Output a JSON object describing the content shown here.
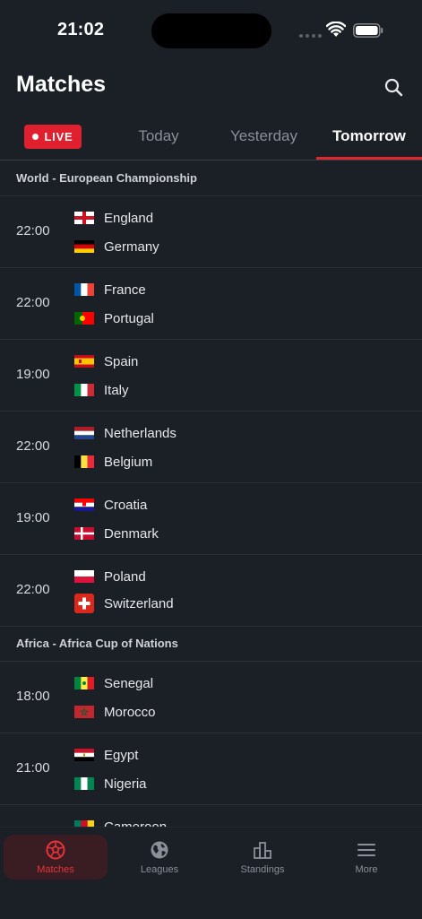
{
  "status": {
    "time": "21:02"
  },
  "header": {
    "title": "Matches",
    "search_icon": "search-icon"
  },
  "tabs": [
    {
      "label": "LIVE",
      "active": false
    },
    {
      "label": "Today",
      "active": false
    },
    {
      "label": "Yesterday",
      "active": false
    },
    {
      "label": "Tomorrow",
      "active": true
    }
  ],
  "leagues": [
    {
      "name": "World - European Championship",
      "matches": [
        {
          "time": "22:00",
          "home": "England",
          "away": "Germany"
        },
        {
          "time": "22:00",
          "home": "France",
          "away": "Portugal"
        },
        {
          "time": "19:00",
          "home": "Spain",
          "away": "Italy"
        },
        {
          "time": "22:00",
          "home": "Netherlands",
          "away": "Belgium"
        },
        {
          "time": "19:00",
          "home": "Croatia",
          "away": "Denmark"
        },
        {
          "time": "22:00",
          "home": "Poland",
          "away": "Switzerland"
        }
      ]
    },
    {
      "name": "Africa - Africa Cup of Nations",
      "matches": [
        {
          "time": "18:00",
          "home": "Senegal",
          "away": "Morocco"
        },
        {
          "time": "21:00",
          "home": "Egypt",
          "away": "Nigeria"
        },
        {
          "time": "",
          "home": "Cameroon",
          "away": ""
        }
      ]
    }
  ],
  "nav": [
    {
      "label": "Matches",
      "icon": "soccer-ball-icon",
      "active": true
    },
    {
      "label": "Leagues",
      "icon": "globe-icon",
      "active": false
    },
    {
      "label": "Standings",
      "icon": "podium-icon",
      "active": false
    },
    {
      "label": "More",
      "icon": "menu-icon",
      "active": false
    }
  ],
  "colors": {
    "accent": "#e0262f",
    "background": "#1b1f26"
  }
}
